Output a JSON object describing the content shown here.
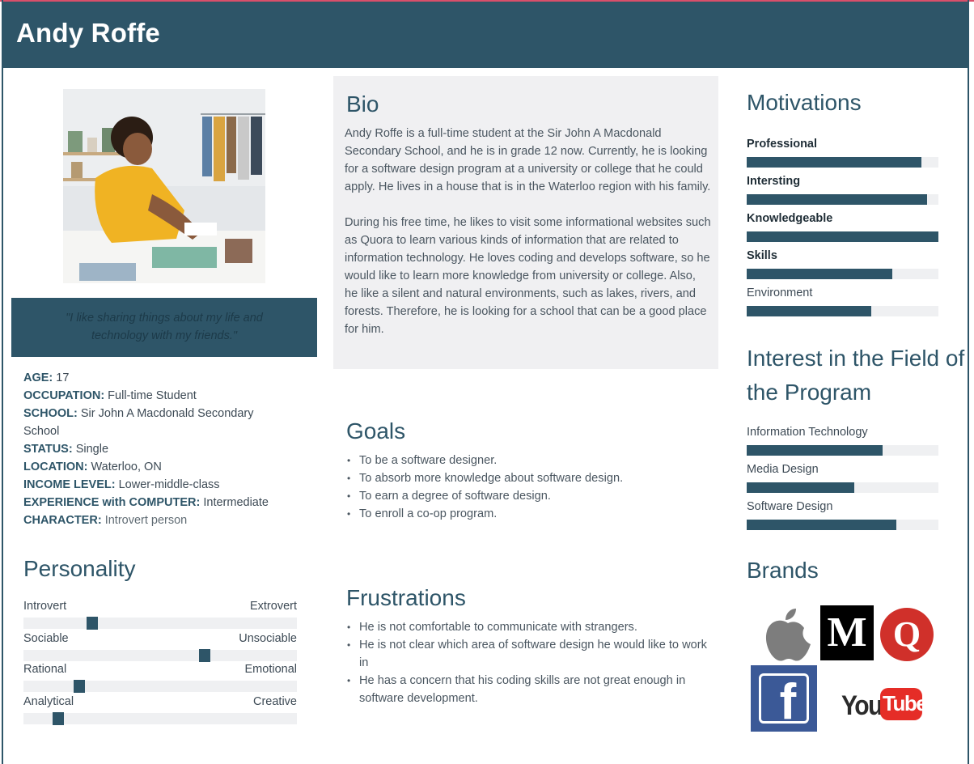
{
  "header": {
    "name": "Andy Roffe"
  },
  "quote": "\"I like sharing things about my life and technology with my friends.\"",
  "facts": [
    {
      "key": "AGE:",
      "value": " 17"
    },
    {
      "key": "OCCUPATION:",
      "value": " Full-time Student"
    },
    {
      "key": "SCHOOL:",
      "value": " Sir John A Macdonald Secondary School"
    },
    {
      "key": "STATUS:",
      "value": " Single"
    },
    {
      "key": "LOCATION:",
      "value": " Waterloo, ON"
    },
    {
      "key": "INCOME LEVEL:",
      "value": " Lower-middle-class"
    },
    {
      "key": "EXPERIENCE with COMPUTER:",
      "value": " Intermediate"
    },
    {
      "key": "CHARACTER:",
      "value": " Introvert person"
    }
  ],
  "personality": {
    "title": "Personality",
    "traits": [
      {
        "left": "Introvert",
        "right": "Extrovert",
        "level": 0.24
      },
      {
        "left": "Sociable",
        "right": "Unsociable",
        "level": 0.67
      },
      {
        "left": "Rational",
        "right": "Emotional",
        "level": 0.19
      },
      {
        "left": "Analytical",
        "right": "Creative",
        "level": 0.11
      }
    ]
  },
  "bio": {
    "title": "Bio",
    "paragraphs": [
      "Andy Roffe is a full-time student at the Sir John A Macdonald Secondary School, and he is in grade 12 now. Currently, he is looking for a software design program at a university or college that he could apply. He lives in a house that is in the Waterloo region with his family.",
      "During his free time, he likes to visit some informational websites such as Quora to learn various kinds of information that are related to information technology. He loves coding and develops software, so he would like to learn more knowledge from university or college. Also, he like a silent and natural environments, such as lakes, rivers, and forests. Therefore, he is looking for a school that can be a good place for him."
    ]
  },
  "goals": {
    "title": "Goals",
    "items": [
      "To be a software designer.",
      "To absorb more knowledge about software design.",
      "To earn a degree of software design.",
      "To enroll a co-op program."
    ]
  },
  "frustrations": {
    "title": "Frustrations",
    "items": [
      "He is not comfortable to communicate with strangers.",
      "He is not clear which area of software design he would like to work in",
      "He has a concern that his coding skills are not great enough in software development."
    ]
  },
  "motivations": {
    "title": "Motivations",
    "items": [
      {
        "label": "Professional",
        "bold": true,
        "level": 0.91
      },
      {
        "label": "Intersting",
        "bold": true,
        "level": 0.94
      },
      {
        "label": "Knowledgeable",
        "bold": true,
        "level": 1.0
      },
      {
        "label": "Skills",
        "bold": true,
        "level": 0.76
      },
      {
        "label": "Environment",
        "bold": false,
        "level": 0.65
      }
    ]
  },
  "interest": {
    "title": "Interest in the Field of the Program",
    "items": [
      {
        "label": "Information Technology",
        "level": 0.71
      },
      {
        "label": "Media Design",
        "level": 0.56
      },
      {
        "label": "Software Design",
        "level": 0.78
      }
    ]
  },
  "brands": {
    "title": "Brands",
    "logos": [
      {
        "name": "apple-logo"
      },
      {
        "name": "medium-logo",
        "text": "M"
      },
      {
        "name": "quora-logo",
        "text": "Q"
      },
      {
        "name": "facebook-logo",
        "text": "f"
      },
      {
        "name": "youtube-logo",
        "text_a": "You",
        "text_b": "Tube"
      }
    ]
  },
  "colors": {
    "primary": "#2e5568",
    "accent": "#d94f6a",
    "panel": "#f0f0f2",
    "track": "#eff0f2"
  }
}
